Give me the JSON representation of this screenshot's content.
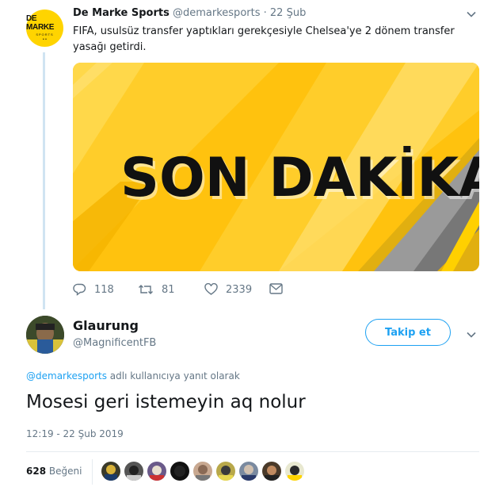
{
  "tweet": {
    "display_name": "De Marke Sports",
    "handle": "@demarkesports",
    "separator": "·",
    "date": "22 Şub",
    "avatar_text_main": "DE MARKE",
    "avatar_text_sub": "SPORTS",
    "avatar_text_dots": "• •",
    "text": "FIFA, usulsüz transfer yaptıkları gerekçesiyle Chelsea'ye 2 dönem transfer yasağı getirdi.",
    "media_text": "SON DAKİKA",
    "replies": "118",
    "retweets": "81",
    "likes": "2339"
  },
  "reply": {
    "display_name": "Glaurung",
    "handle": "@MagnificentFB",
    "follow_label": "Takip et",
    "reply_to_mention": "@demarkesports",
    "reply_to_suffix": " adlı kullanıcıya yanıt olarak",
    "text": "Mosesi geri istemeyin aq nolur",
    "timestamp": "12:19 - 22 Şub 2019",
    "likes_count": "628",
    "likes_label": "Beğeni"
  },
  "icons": {
    "menu": "chevron-down-icon",
    "reply": "reply-icon",
    "retweet": "retweet-icon",
    "like": "heart-icon",
    "dm": "envelope-icon"
  },
  "colors": {
    "accent": "#1da1f2",
    "muted": "#657786",
    "media_yellow": "#ffc20e"
  }
}
